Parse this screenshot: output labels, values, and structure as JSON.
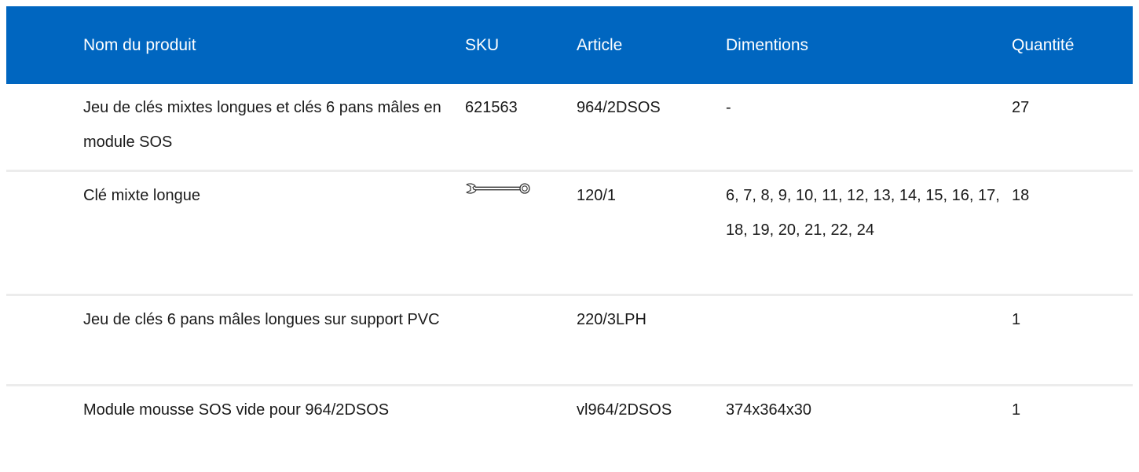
{
  "table": {
    "headers": {
      "name": "Nom du produit",
      "sku": "SKU",
      "article": "Article",
      "dimensions": "Dimentions",
      "quantity": "Quantité"
    },
    "rows": [
      {
        "name": "Jeu de clés mixtes longues et clés 6 pans mâles en module SOS",
        "sku": "621563",
        "article": "964/2DSOS",
        "dimensions": "-",
        "quantity": "27"
      },
      {
        "name": "Clé mixte longue",
        "sku_icon": "combination-wrench-icon",
        "article": "120/1",
        "dimensions": "6, 7, 8, 9, 10, 11, 12, 13, 14, 15, 16, 17, 18, 19, 20, 21, 22, 24",
        "quantity": "18"
      },
      {
        "name": "Jeu de clés 6 pans mâles longues sur support PVC",
        "sku": "",
        "article": "220/3LPH",
        "dimensions": "",
        "quantity": "1"
      },
      {
        "name": "Module mousse SOS vide pour 964/2DSOS",
        "sku": "",
        "article": "vl964/2DSOS",
        "dimensions": "374x364x30",
        "quantity": "1"
      }
    ]
  },
  "colors": {
    "header_bg": "#0066c0",
    "header_text": "#ffffff",
    "row_divider": "#ececec"
  }
}
